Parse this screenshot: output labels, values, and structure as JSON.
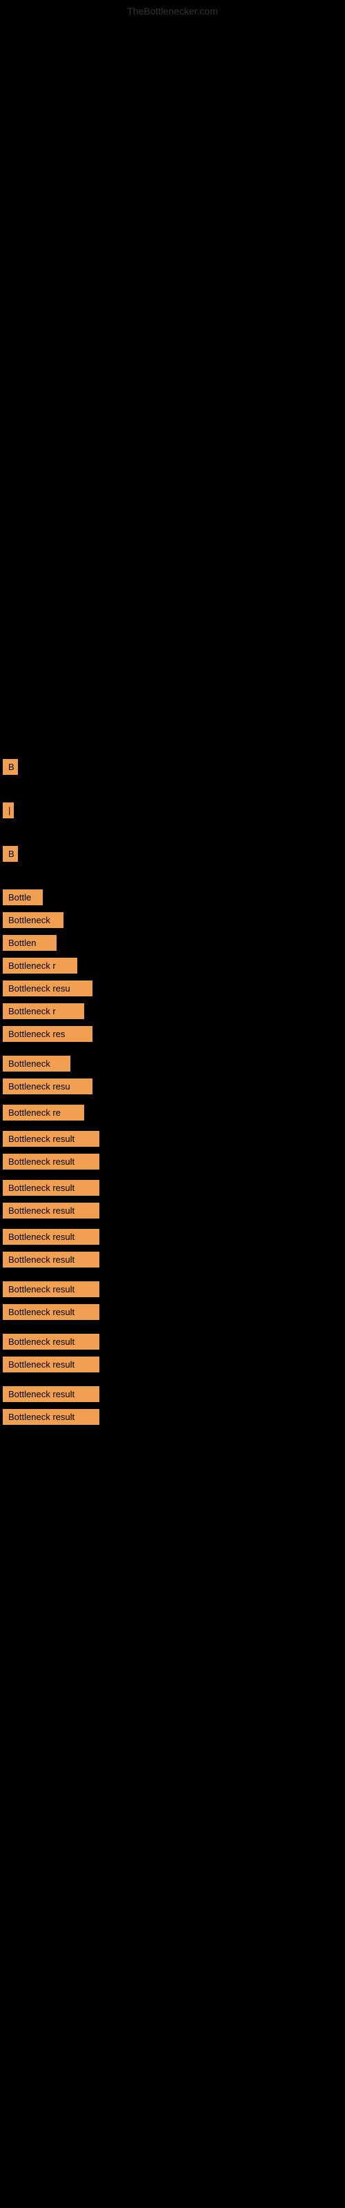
{
  "site": {
    "title": "TheBottlenecker.com"
  },
  "items": [
    {
      "id": "b1",
      "label": "B",
      "class": "b1"
    },
    {
      "id": "b2",
      "label": "|",
      "class": "b2"
    },
    {
      "id": "b3",
      "label": "B",
      "class": "b3"
    },
    {
      "id": "b4",
      "label": "Bottle",
      "class": "b4"
    },
    {
      "id": "b5",
      "label": "Bottleneck",
      "class": "b5"
    },
    {
      "id": "b6",
      "label": "Bottlen",
      "class": "b6"
    },
    {
      "id": "b7",
      "label": "Bottleneck r",
      "class": "b7"
    },
    {
      "id": "b8",
      "label": "Bottleneck resu",
      "class": "b8"
    },
    {
      "id": "b9",
      "label": "Bottleneck r",
      "class": "b9"
    },
    {
      "id": "b10",
      "label": "Bottleneck res",
      "class": "b10"
    },
    {
      "id": "b11",
      "label": "Bottleneck",
      "class": "b11"
    },
    {
      "id": "b12",
      "label": "Bottleneck resu",
      "class": "b12"
    },
    {
      "id": "b13",
      "label": "Bottleneck re",
      "class": "b13"
    },
    {
      "id": "b14",
      "label": "Bottleneck result",
      "class": "b14"
    },
    {
      "id": "b15",
      "label": "Bottleneck result",
      "class": "b15"
    },
    {
      "id": "b16",
      "label": "Bottleneck result",
      "class": "b16"
    },
    {
      "id": "b17",
      "label": "Bottleneck result",
      "class": "b17"
    },
    {
      "id": "b18",
      "label": "Bottleneck result",
      "class": "b18"
    },
    {
      "id": "b19",
      "label": "Bottleneck result",
      "class": "b19"
    },
    {
      "id": "b20",
      "label": "Bottleneck result",
      "class": "b20"
    },
    {
      "id": "b21",
      "label": "Bottleneck result",
      "class": "b21"
    },
    {
      "id": "b22",
      "label": "Bottleneck result",
      "class": "b22"
    },
    {
      "id": "b23",
      "label": "Bottleneck result",
      "class": "b23"
    },
    {
      "id": "b24",
      "label": "Bottleneck result",
      "class": "b24"
    },
    {
      "id": "b25",
      "label": "Bottleneck result",
      "class": "b25"
    }
  ]
}
